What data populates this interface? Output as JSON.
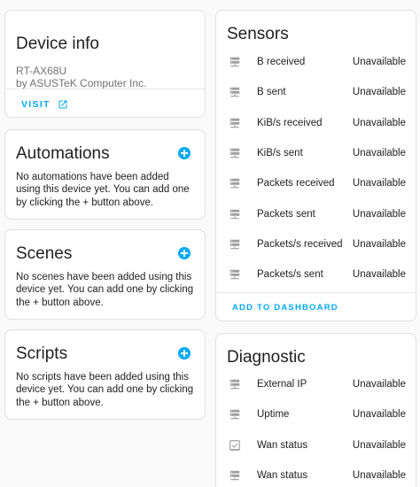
{
  "device_info": {
    "title": "Device info",
    "model": "RT-AX68U",
    "manufacturer": "by ASUSTeK Computer Inc.",
    "visit_label": "VISIT"
  },
  "automations": {
    "title": "Automations",
    "description": "No automations have been added using this device yet. You can add one by clicking the + button above."
  },
  "scenes": {
    "title": "Scenes",
    "description": "No scenes have been added using this device yet. You can add one by clicking the + button above."
  },
  "scripts": {
    "title": "Scripts",
    "description": "No scripts have been added using this device yet. You can add one by clicking the + button above."
  },
  "sensors": {
    "title": "Sensors",
    "items": [
      {
        "name": "B received",
        "state": "Unavailable",
        "icon": "server-network-icon"
      },
      {
        "name": "B sent",
        "state": "Unavailable",
        "icon": "server-network-icon"
      },
      {
        "name": "KiB/s received",
        "state": "Unavailable",
        "icon": "server-network-icon"
      },
      {
        "name": "KiB/s sent",
        "state": "Unavailable",
        "icon": "server-network-icon"
      },
      {
        "name": "Packets received",
        "state": "Unavailable",
        "icon": "server-network-icon"
      },
      {
        "name": "Packets sent",
        "state": "Unavailable",
        "icon": "server-network-icon"
      },
      {
        "name": "Packets/s received",
        "state": "Unavailable",
        "icon": "server-network-icon"
      },
      {
        "name": "Packets/s sent",
        "state": "Unavailable",
        "icon": "server-network-icon"
      }
    ],
    "add_to_dashboard_label": "ADD TO DASHBOARD"
  },
  "diagnostic": {
    "title": "Diagnostic",
    "items": [
      {
        "name": "External IP",
        "state": "Unavailable",
        "icon": "server-network-icon"
      },
      {
        "name": "Uptime",
        "state": "Unavailable",
        "icon": "server-network-icon"
      },
      {
        "name": "Wan status",
        "state": "Unavailable",
        "icon": "checkbox-marked-icon"
      },
      {
        "name": "Wan status",
        "state": "Unavailable",
        "icon": "server-network-icon"
      }
    ]
  },
  "colors": {
    "accent": "#03a9f4",
    "icon_gray": "#9e9e9e",
    "background": "#fafafa",
    "card": "#ffffff"
  }
}
